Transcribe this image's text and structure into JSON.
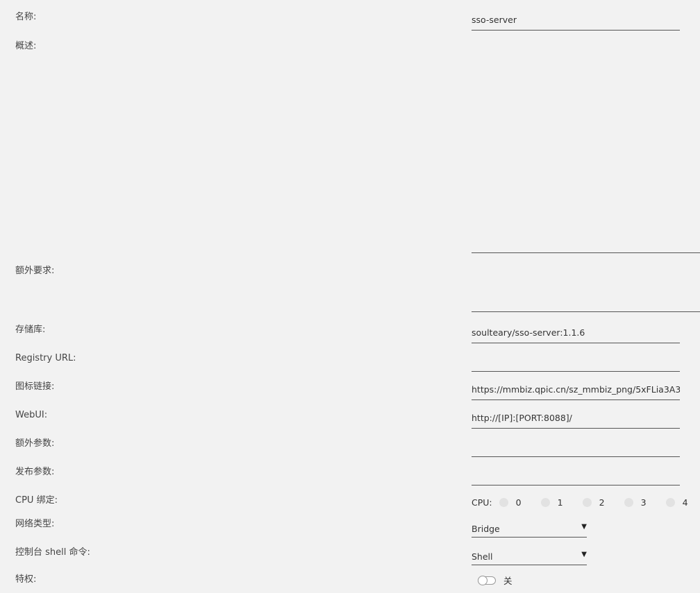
{
  "labels": {
    "name": "名称:",
    "description": "概述:",
    "requirements": "额外要求:",
    "repository": "存储库:",
    "registry_url": "Registry URL:",
    "icon_url": "图标链接:",
    "webui": "WebUI:",
    "extra_params": "额外参数:",
    "post_args": "发布参数:",
    "cpu_pinning": "CPU 绑定:",
    "network_type": "网络类型:",
    "console_shell": "控制台 shell 命令:",
    "privileged": "特权:"
  },
  "values": {
    "name": "sso-server",
    "description": "",
    "requirements": "",
    "repository": "soulteary/sso-server:1.1.6",
    "registry_url": "",
    "icon_url": "https://mmbiz.qpic.cn/sz_mmbiz_png/5xFLia3A3kr",
    "webui": "http://[IP]:[PORT:8088]/",
    "extra_params": "",
    "post_args": ""
  },
  "cpu": {
    "title": "CPU:",
    "options": [
      "0",
      "1",
      "2",
      "3",
      "4"
    ]
  },
  "network_type": {
    "selected": "Bridge",
    "arrow": "▼"
  },
  "console_shell": {
    "selected": "Shell",
    "arrow": "▼"
  },
  "privileged": {
    "state_label": "关"
  }
}
